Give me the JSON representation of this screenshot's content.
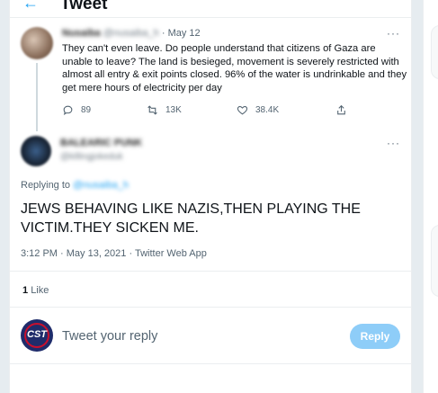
{
  "header": {
    "title": "Tweet",
    "back_icon": "←"
  },
  "parent_tweet": {
    "name": "Nusaiba",
    "handle": "@nusaiba_h",
    "separator": "·",
    "date": "May 12",
    "more": "···",
    "text": "They can't even leave. Do people understand that citizens of Gaza are unable to leave? The land is besieged, movement is severely restricted with almost all entry & exit points closed. 96% of the water is undrinkable and they get mere hours of electricity per day",
    "replies": "89",
    "retweets": "13K",
    "likes": "38.4K"
  },
  "main_tweet": {
    "name": "BALEARIC PUNK",
    "handle": "@killingjokeduk",
    "more": "···",
    "replying_label": "Replying to",
    "replying_to": "@nusaiba_h",
    "text": "JEWS BEHAVING LIKE NAZIS,THEN PLAYING THE VICTIM.THEY SICKEN ME.",
    "meta": "3:12 PM · May 13, 2021 · Twitter Web App",
    "like_count": "1",
    "like_label": "Like"
  },
  "composer": {
    "avatar_text": "CST",
    "placeholder": "Tweet your reply",
    "reply_label": "Reply"
  },
  "colors": {
    "accent": "#1da1f2",
    "reply_button_disabled": "#8ecdf8",
    "secondary_text": "#536471",
    "border": "#ebeef0"
  }
}
